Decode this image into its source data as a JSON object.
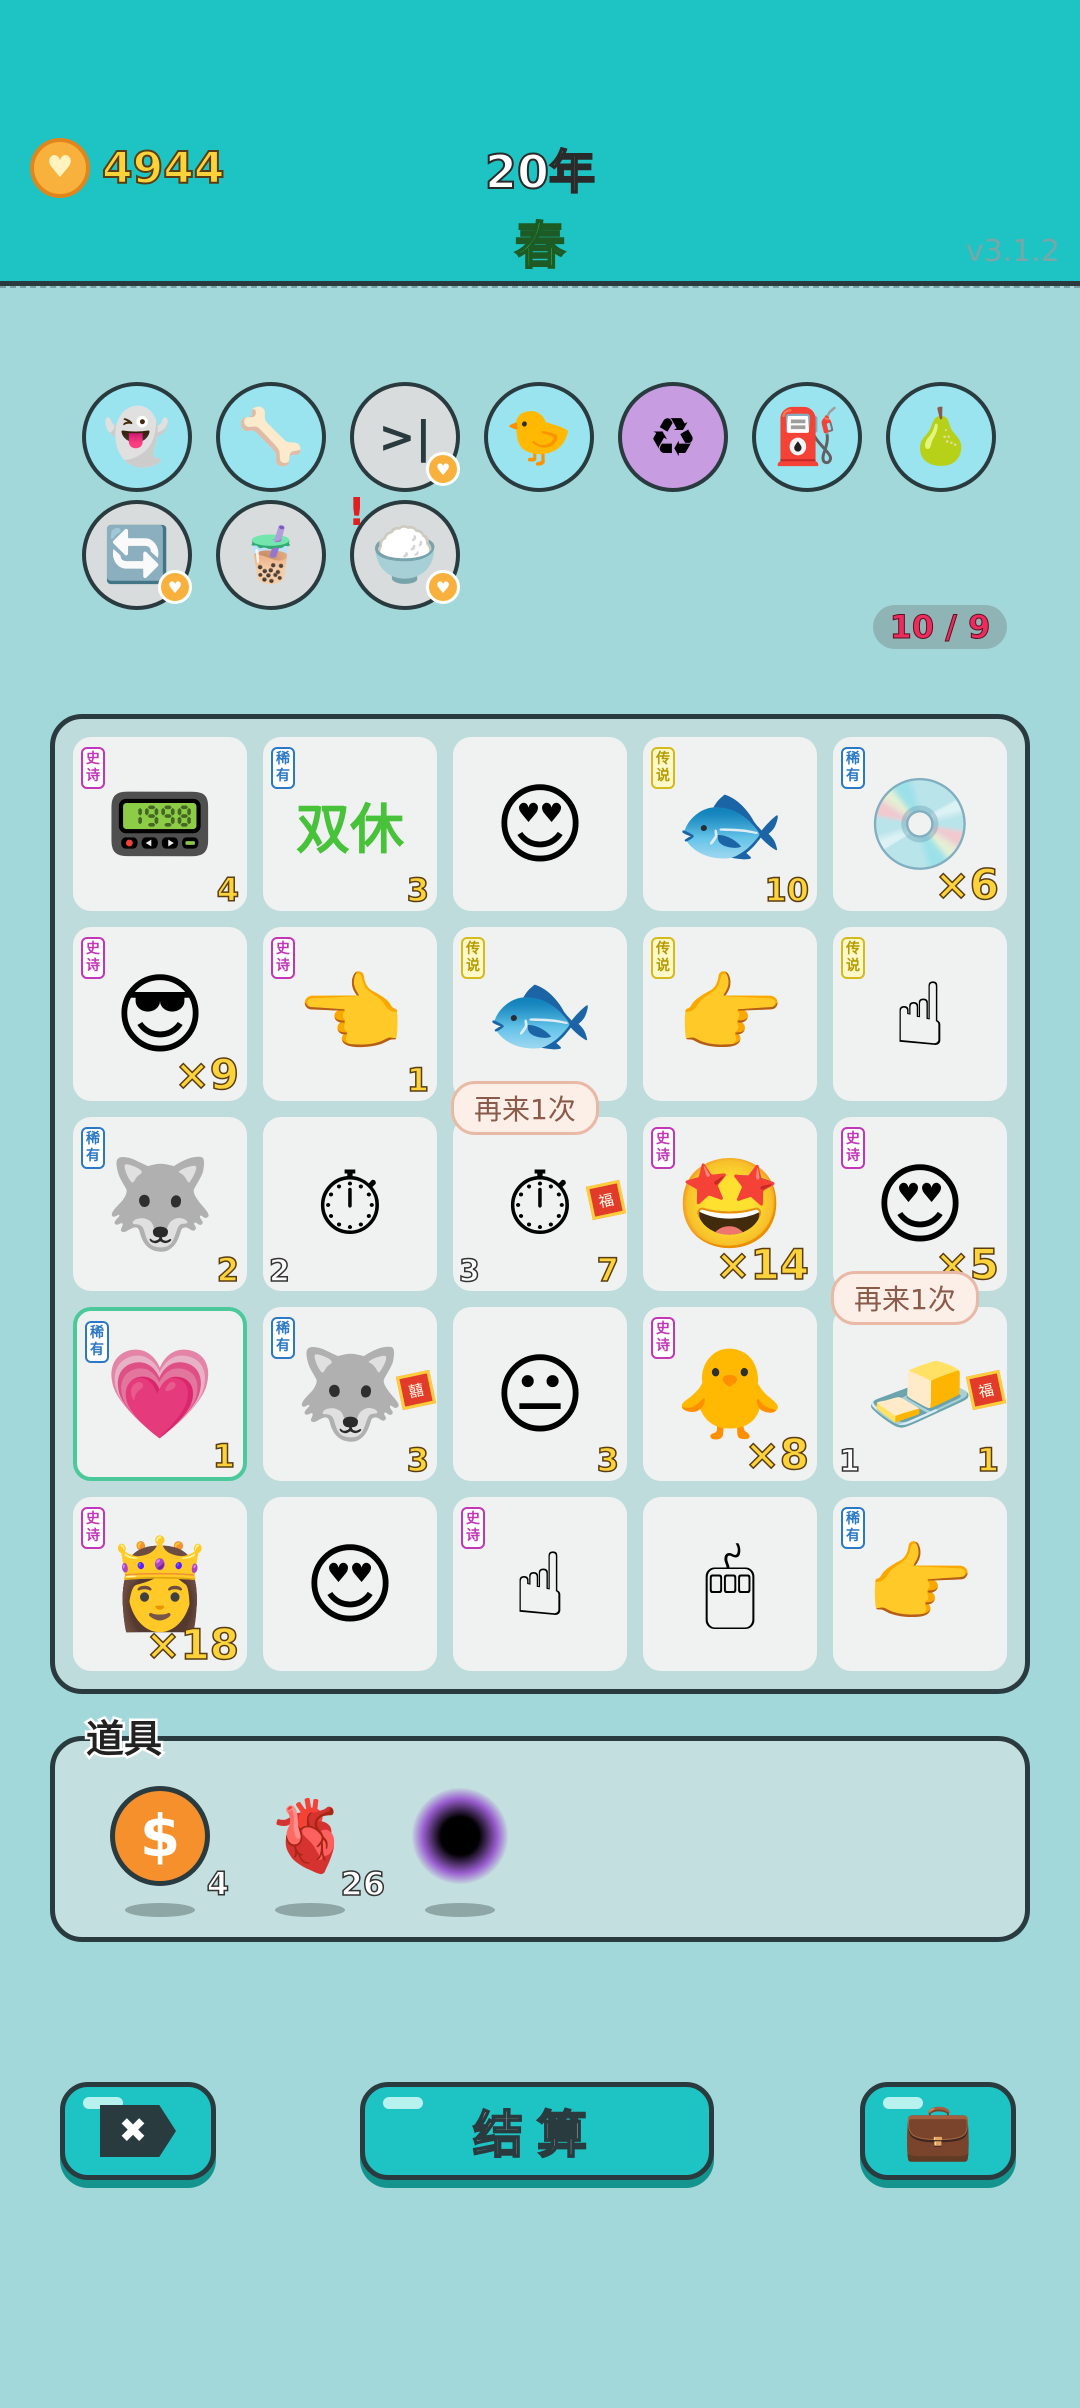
{
  "header": {
    "coins": "4944",
    "year": "20年",
    "season": "春",
    "version": "v3.1.2"
  },
  "buff_icons": [
    {
      "icon": "ghost-robot-icon",
      "glyph": "👻",
      "bg": "#99e4ef",
      "heart": false
    },
    {
      "icon": "pet-bowl-icon",
      "glyph": "🦴",
      "bg": "#99e4ef",
      "heart": false
    },
    {
      "icon": "skip-icon",
      "glyph": ">|",
      "bg": "#d9dcdc",
      "heart": true
    },
    {
      "icon": "syringe-chick-icon",
      "glyph": "🐤",
      "bg": "#99e4ef",
      "heart": false
    },
    {
      "icon": "recycle-icon",
      "glyph": "♻",
      "bg": "#c79ce0",
      "heart": false
    },
    {
      "icon": "pump-icon",
      "glyph": "⛽",
      "bg": "#99e4ef",
      "heart": false
    },
    {
      "icon": "pomelo-icon",
      "glyph": "🍐",
      "bg": "#99e4ef",
      "heart": false
    },
    {
      "icon": "refresh-icon",
      "glyph": "🔄",
      "bg": "#d9dcdc",
      "heart": true
    },
    {
      "icon": "milk-tea-icon",
      "glyph": "🧋",
      "bg": "#d9dcdc",
      "heart": false
    },
    {
      "icon": "rice-bowl-icon",
      "glyph": "🍚",
      "bg": "#d9dcdc",
      "heart": true,
      "alert": "!"
    }
  ],
  "capacity": "10 / 9",
  "grid": [
    {
      "tag": "史诗",
      "tier": "epic",
      "icon": "gpu-card-icon",
      "glyph": "📟",
      "count": "4"
    },
    {
      "tag": "稀有",
      "tier": "rare",
      "icon": "double-rest-icon",
      "glyph": "双休",
      "count": "3"
    },
    {
      "tag": "",
      "tier": "",
      "icon": "old-man-heart-eyes-icon",
      "glyph": "😍",
      "count": ""
    },
    {
      "tag": "传说",
      "tier": "leg",
      "icon": "koi-fish-icon",
      "glyph": "🐟",
      "count": "10"
    },
    {
      "tag": "稀有",
      "tier": "rare",
      "icon": "cd-disc-icon",
      "glyph": "💿",
      "count": "×6"
    },
    {
      "tag": "史诗",
      "tier": "epic",
      "icon": "green-hair-man-icon",
      "glyph": "😎",
      "count": "×9"
    },
    {
      "tag": "史诗",
      "tier": "epic",
      "icon": "pointing-hand-icon",
      "glyph": "👈",
      "count": "1"
    },
    {
      "tag": "传说",
      "tier": "leg",
      "icon": "koi-fish-icon",
      "glyph": "🐟",
      "count": ""
    },
    {
      "tag": "传说",
      "tier": "leg",
      "icon": "yellow-point-hand-icon",
      "glyph": "👉",
      "count": ""
    },
    {
      "tag": "传说",
      "tier": "leg",
      "icon": "yellow-up-hand-icon",
      "glyph": "☝",
      "count": ""
    },
    {
      "tag": "稀有",
      "tier": "rare",
      "icon": "husky-dog-icon",
      "glyph": "🐺",
      "count": "2"
    },
    {
      "tag": "",
      "tier": "",
      "icon": "stopwatch-card-icon",
      "glyph": "⏱",
      "count": "",
      "left": "2"
    },
    {
      "tag": "",
      "tier": "",
      "icon": "stopwatch-card-icon",
      "glyph": "⏱",
      "count": "7",
      "left": "3",
      "fu": "福",
      "tip": "再来1次"
    },
    {
      "tag": "史诗",
      "tier": "epic",
      "icon": "green-hair-star-icon",
      "glyph": "🤩",
      "count": "×14"
    },
    {
      "tag": "史诗",
      "tier": "epic",
      "icon": "grandpa-heart-eyes-icon",
      "glyph": "😍",
      "count": "×5"
    },
    {
      "tag": "稀有",
      "tier": "rare",
      "icon": "heart-hammer-icon",
      "glyph": "💗",
      "count": "1",
      "sel": true
    },
    {
      "tag": "稀有",
      "tier": "rare",
      "icon": "husky-wedding-icon",
      "glyph": "🐺",
      "count": "3",
      "fu": "囍"
    },
    {
      "tag": "",
      "tier": "",
      "icon": "tired-man-icon",
      "glyph": "😐",
      "count": "3"
    },
    {
      "tag": "史诗",
      "tier": "epic",
      "icon": "lucky-duck-icon",
      "glyph": "🐥",
      "count": "×8"
    },
    {
      "tag": "",
      "tier": "",
      "icon": "gold-bars-card-icon",
      "glyph": "🧈",
      "count": "1",
      "left": "1",
      "fu": "福",
      "tip": "再来1次"
    },
    {
      "tag": "史诗",
      "tier": "epic",
      "icon": "queen-girl-icon",
      "glyph": "👸",
      "count": "×18"
    },
    {
      "tag": "",
      "tier": "",
      "icon": "man-heart-eyes-icon",
      "glyph": "😍",
      "count": ""
    },
    {
      "tag": "史诗",
      "tier": "epic",
      "icon": "gray-point-hand-icon",
      "glyph": "☝",
      "count": ""
    },
    {
      "tag": "",
      "tier": "",
      "icon": "mouse-icon",
      "glyph": "🖱",
      "count": ""
    },
    {
      "tag": "稀有",
      "tier": "rare",
      "icon": "brown-point-hand-icon",
      "glyph": "👉",
      "count": ""
    }
  ],
  "props": {
    "title": "道具",
    "items": [
      {
        "icon": "dollar-coin-icon",
        "glyph": "$",
        "count": "4"
      },
      {
        "icon": "liver-icon",
        "glyph": "🫀",
        "count": "26"
      },
      {
        "icon": "black-hole-icon",
        "glyph": "●",
        "count": ""
      }
    ]
  },
  "buttons": {
    "close_glyph": "✖",
    "settle_label": "结算",
    "bag_glyph": "💼"
  }
}
